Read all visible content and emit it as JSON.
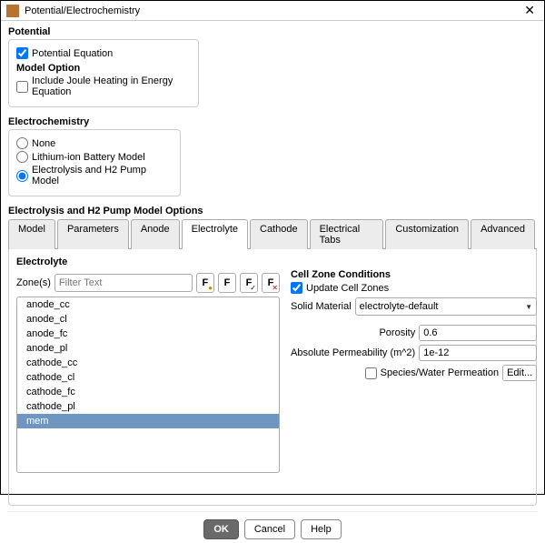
{
  "window": {
    "title": "Potential/Electrochemistry"
  },
  "potential": {
    "heading": "Potential",
    "potential_equation": {
      "label": "Potential Equation",
      "checked": true
    },
    "model_option_heading": "Model Option",
    "joule_heating": {
      "label": "Include Joule Heating in Energy Equation",
      "checked": false
    }
  },
  "electrochem": {
    "heading": "Electrochemistry",
    "options": [
      {
        "label": "None",
        "checked": false
      },
      {
        "label": "Lithium-ion Battery Model",
        "checked": false
      },
      {
        "label": "Electrolysis and H2 Pump Model",
        "checked": true
      }
    ]
  },
  "modelOptions": {
    "heading": "Electrolysis and H2 Pump Model Options",
    "tabs": [
      "Model",
      "Parameters",
      "Anode",
      "Electrolyte",
      "Cathode",
      "Electrical Tabs",
      "Customization",
      "Advanced"
    ],
    "active_tab": "Electrolyte"
  },
  "electrolyteTab": {
    "heading": "Electrolyte",
    "zone_label": "Zone(s)",
    "filter_placeholder": "Filter Text",
    "zones": [
      "anode_cc",
      "anode_cl",
      "anode_fc",
      "anode_pl",
      "cathode_cc",
      "cathode_cl",
      "cathode_fc",
      "cathode_pl",
      "mem"
    ],
    "selected_zone": "mem",
    "cell_zone_heading": "Cell Zone Conditions",
    "update_cell_zones": {
      "label": "Update Cell Zones",
      "checked": true
    },
    "solid_material_label": "Solid Material",
    "solid_material_value": "electrolyte-default",
    "porosity_label": "Porosity",
    "porosity_value": "0.6",
    "abs_perm_label": "Absolute Permeability (m^2)",
    "abs_perm_value": "1e-12",
    "species_perm": {
      "label": "Species/Water Permeation",
      "checked": false
    },
    "edit_label": "Edit..."
  },
  "buttons": {
    "ok": "OK",
    "cancel": "Cancel",
    "help": "Help"
  }
}
